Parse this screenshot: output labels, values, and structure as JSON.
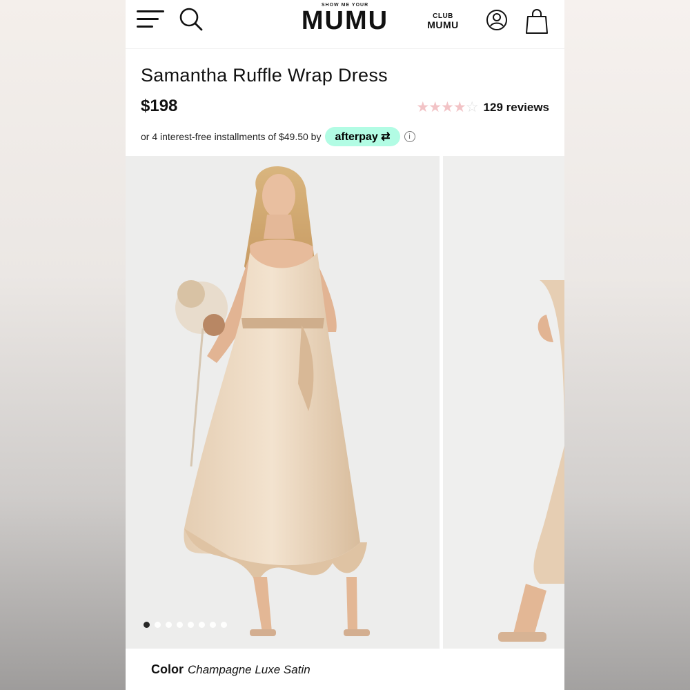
{
  "header": {
    "logo_small": "SHOW ME YOUR",
    "logo_main": "MUMU",
    "club_line1": "CLUB",
    "club_line2": "MUMU"
  },
  "product": {
    "title": "Samantha Ruffle Wrap Dress",
    "price": "$198",
    "rating_stars": 4,
    "reviews": "129 reviews",
    "installments_text": "or 4 interest-free installments of $49.50 by",
    "afterpay_label": "afterpay",
    "info_symbol": "i"
  },
  "gallery": {
    "total_images": 8,
    "active_index": 0
  },
  "color": {
    "label": "Color",
    "value": "Champagne Luxe Satin"
  },
  "colors": {
    "afterpay_bg": "#b2fce4",
    "star_filled": "#f2c3c6",
    "dress": "#e9d3b9"
  },
  "icons": [
    "menu-icon",
    "search-icon",
    "account-icon",
    "bag-icon",
    "star-icon",
    "info-icon"
  ]
}
